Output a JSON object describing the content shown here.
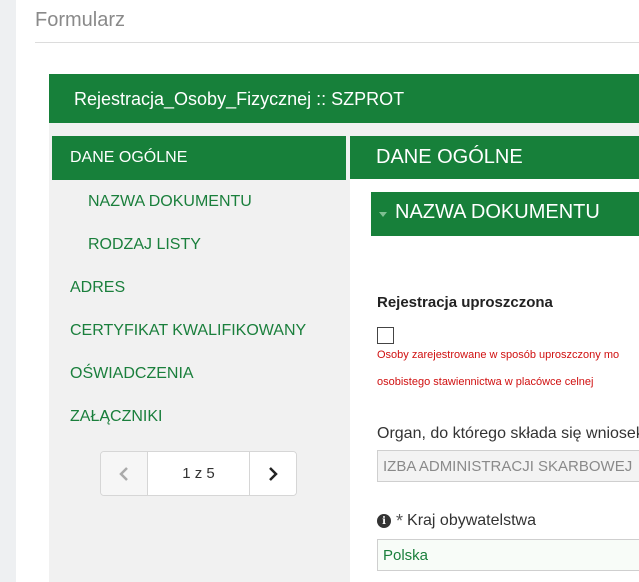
{
  "page": {
    "title": "Formularz"
  },
  "form": {
    "header": "Rejestracja_Osoby_Fizycznej :: SZPROT"
  },
  "nav": {
    "items": [
      {
        "label": "DANE OGÓLNE"
      },
      {
        "label": "NAZWA DOKUMENTU"
      },
      {
        "label": "RODZAJ LISTY"
      },
      {
        "label": "ADRES"
      },
      {
        "label": "CERTYFIKAT KWALIFIKOWANY"
      },
      {
        "label": "OŚWIADCZENIA"
      },
      {
        "label": "ZAŁĄCZNIKI"
      }
    ]
  },
  "pager": {
    "info": "1 z 5"
  },
  "content": {
    "section": "DANE OGÓLNE",
    "subsection": "NAZWA DOKUMENTU",
    "simplified_label": "Rejestracja uproszczona",
    "warning_line1": "Osoby zarejestrowane w sposób uproszczony mo",
    "warning_line2": "osobistego stawiennictwa w placówce celnej",
    "organ_label": "Organ, do którego składa się wniosek",
    "organ_value": "IZBA ADMINISTRACJI SKARBOWEJ",
    "country_label": "Kraj obywatelstwa",
    "country_value": "Polska"
  },
  "colors": {
    "brand_green": "#17803a",
    "warning_red": "#d01010"
  },
  "icons": {
    "prev": "chevron-left-icon",
    "next": "chevron-right-icon",
    "info": "info-icon",
    "required": "asterisk-icon",
    "collapse": "caret-down-icon"
  }
}
